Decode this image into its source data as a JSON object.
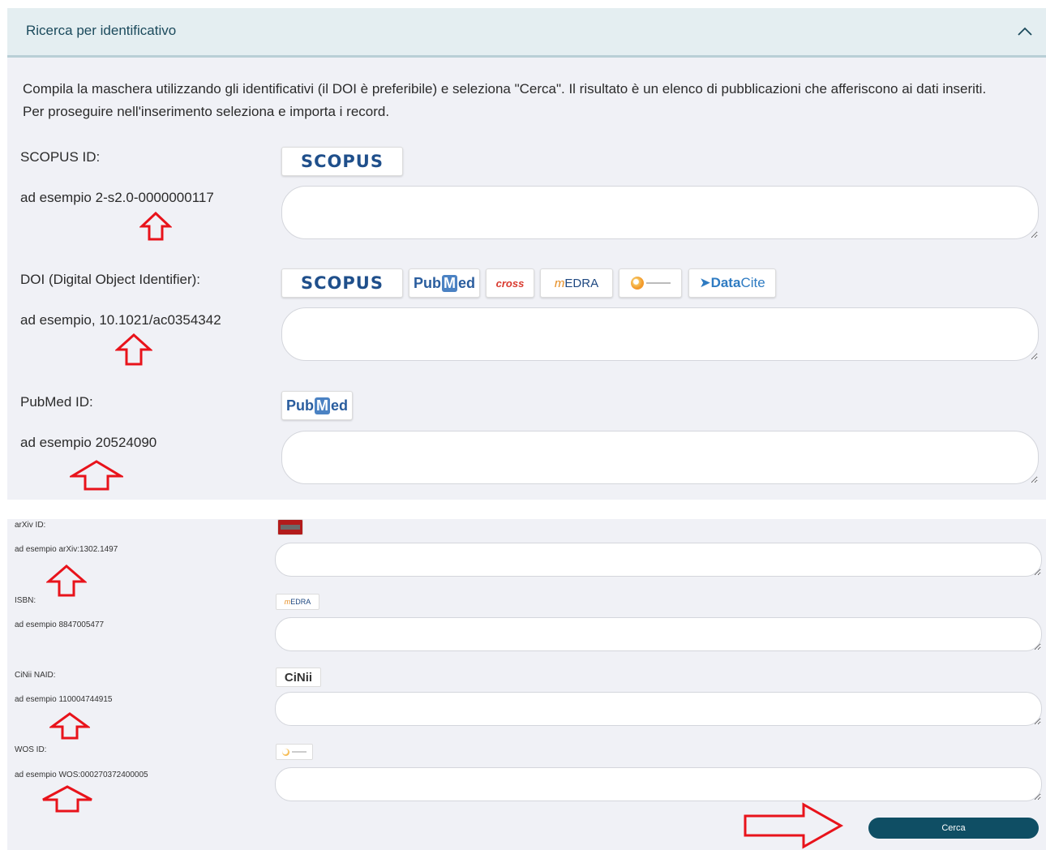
{
  "panel": {
    "title": "Ricerca per identificativo",
    "intro_line1": "Compila la maschera utilizzando gli identificativi (il DOI è preferibile) e seleziona \"Cerca\". Il risultato è un elenco di pubblicazioni che afferiscono ai dati inseriti.",
    "intro_line2": "Per proseguire nell'inserimento seleziona e importa i record."
  },
  "fields_top": [
    {
      "label": "SCOPUS ID:",
      "example": "ad esempio 2-s2.0-0000000117",
      "logos": [
        "scopus"
      ]
    },
    {
      "label": "DOI (Digital Object Identifier):",
      "example": "ad esempio, 10.1021/ac0354342",
      "logos": [
        "scopus",
        "pubmed",
        "crossref",
        "medra",
        "webofscience",
        "datacite"
      ]
    },
    {
      "label": "PubMed ID:",
      "example": "ad esempio 20524090",
      "logos": [
        "pubmed"
      ]
    }
  ],
  "fields_bottom": [
    {
      "label": "arXiv ID:",
      "example": "ad esempio arXiv:1302.1497",
      "logos": [
        "arxiv"
      ]
    },
    {
      "label": "ISBN:",
      "example": "ad esempio 8847005477",
      "logos": [
        "medra"
      ]
    },
    {
      "label": "CiNii NAID:",
      "example": "ad esempio 110004744915",
      "logos": [
        "cinii"
      ]
    },
    {
      "label": "WOS ID:",
      "example": "ad esempio WOS:000270372400005",
      "logos": [
        "webofscience"
      ]
    }
  ],
  "logo_text": {
    "scopus": "SCOPUS",
    "pubmed_pub": "Pub",
    "pubmed_m": "M",
    "pubmed_ed": "ed",
    "crossref": "cross",
    "medra_m": "m",
    "medra_edra": "EDRA",
    "datacite_data": "Data",
    "datacite_cite": "Cite",
    "cinii": "CiNii"
  },
  "actions": {
    "search_label": "Cerca"
  },
  "colors": {
    "header_bg": "#e4eef1",
    "panel_bg": "#f0f1f6",
    "button_bg": "#0f4e64",
    "annotation_arrow": "#e8131b"
  },
  "icons": {
    "collapse": "chevron-up-icon",
    "annotation": "arrow-up-icon",
    "annotation_right": "arrow-right-icon"
  }
}
